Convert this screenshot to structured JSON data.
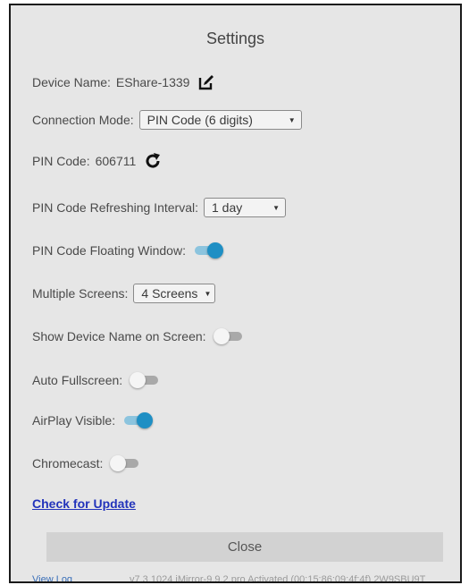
{
  "dialog": {
    "title": "Settings"
  },
  "device_name": {
    "label": "Device Name:",
    "value": "EShare-1339"
  },
  "connection_mode": {
    "label": "Connection Mode:",
    "selected": "PIN Code (6 digits)"
  },
  "pin_code": {
    "label": "PIN Code:",
    "value": "606711"
  },
  "pin_refresh": {
    "label": "PIN Code Refreshing Interval:",
    "selected": "1 day"
  },
  "pin_floating": {
    "label": "PIN Code Floating Window:",
    "on": true
  },
  "multiple_screens": {
    "label": "Multiple Screens:",
    "selected": "4 Screens"
  },
  "show_device_name": {
    "label": "Show Device Name on Screen:",
    "on": false
  },
  "auto_fullscreen": {
    "label": "Auto Fullscreen:",
    "on": false
  },
  "airplay": {
    "label": "AirPlay Visible:",
    "on": true
  },
  "chromecast": {
    "label": "Chromecast:",
    "on": false
  },
  "check_update": {
    "label": "Check for Update"
  },
  "close_button": {
    "label": "Close"
  },
  "footer": {
    "view_log": "View Log",
    "version": "v7.3.1024 iMirror-9.9.2.pro Activated (00:15:86:09:4f:4f) 2W9SBU9T"
  },
  "colors": {
    "toggle_on": "#1f8fc4",
    "toggle_off": "#a9a9a9",
    "link": "#2233bb",
    "background": "#e6e6e6"
  },
  "icons": {
    "edit": "edit-icon",
    "refresh": "refresh-icon"
  }
}
